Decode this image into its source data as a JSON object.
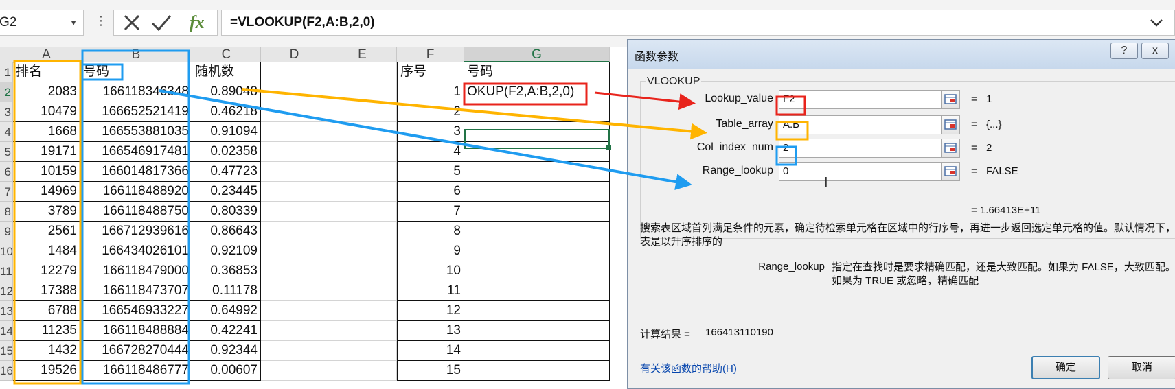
{
  "formula_bar": {
    "name_box": "G2",
    "more": "⋮",
    "cancel_icon": "x-icon",
    "enter_icon": "check-icon",
    "fx": "fx",
    "formula": "=VLOOKUP(F2,A:B,2,0)"
  },
  "columns": [
    "A",
    "B",
    "C",
    "D",
    "E",
    "F",
    "G"
  ],
  "rows": [
    "1",
    "2",
    "3",
    "4",
    "5",
    "6",
    "7",
    "8",
    "9",
    "10",
    "11",
    "12",
    "13",
    "14",
    "15",
    "16"
  ],
  "headers": {
    "A": "排名",
    "B": "号码",
    "C": "随机数",
    "F": "序号",
    "G": "号码"
  },
  "data": [
    {
      "a": "2083",
      "b": "166118346348",
      "c": "0.89048",
      "f": "1",
      "g": "OKUP(F2,A:B,2,0)"
    },
    {
      "a": "10479",
      "b": "166652521419",
      "c": "0.46218",
      "f": "2",
      "g": ""
    },
    {
      "a": "1668",
      "b": "166553881035",
      "c": "0.91094",
      "f": "3",
      "g": ""
    },
    {
      "a": "19171",
      "b": "166546917481",
      "c": "0.02358",
      "f": "4",
      "g": ""
    },
    {
      "a": "10159",
      "b": "166014817366",
      "c": "0.47723",
      "f": "5",
      "g": ""
    },
    {
      "a": "14969",
      "b": "166118488920",
      "c": "0.23445",
      "f": "6",
      "g": ""
    },
    {
      "a": "3789",
      "b": "166118488750",
      "c": "0.80339",
      "f": "7",
      "g": ""
    },
    {
      "a": "2561",
      "b": "166712939616",
      "c": "0.86643",
      "f": "8",
      "g": ""
    },
    {
      "a": "1484",
      "b": "166434026101",
      "c": "0.92109",
      "f": "9",
      "g": ""
    },
    {
      "a": "12279",
      "b": "166118479000",
      "c": "0.36853",
      "f": "10",
      "g": ""
    },
    {
      "a": "17388",
      "b": "166118473707",
      "c": "0.11178",
      "f": "11",
      "g": ""
    },
    {
      "a": "6788",
      "b": "166546933227",
      "c": "0.64992",
      "f": "12",
      "g": ""
    },
    {
      "a": "11235",
      "b": "166118488884",
      "c": "0.42241",
      "f": "13",
      "g": ""
    },
    {
      "a": "1432",
      "b": "166728270444",
      "c": "0.92344",
      "f": "14",
      "g": ""
    },
    {
      "a": "19526",
      "b": "166118486777",
      "c": "0.00607",
      "f": "15",
      "g": ""
    }
  ],
  "dialog": {
    "title": "函数参数",
    "help_btn": "?",
    "close_btn": "x",
    "function_name": "VLOOKUP",
    "args": [
      {
        "label": "Lookup_value",
        "value": "F2",
        "result": "1"
      },
      {
        "label": "Table_array",
        "value": "A:B",
        "result": "{...}"
      },
      {
        "label": "Col_index_num",
        "value": "2",
        "result": "2"
      },
      {
        "label": "Range_lookup",
        "value": "0",
        "result": "FALSE"
      }
    ],
    "eq": "=",
    "formula_result": "=  1.66413E+11",
    "description": "搜索表区域首列满足条件的元素，确定待检索单元格在区域中的行序号，再进一步返回选定单元格的值。默认情况下，表是以升序排序的",
    "arg_name": "Range_lookup",
    "arg_description": "指定在查找时是要求精确匹配，还是大致匹配。如果为 FALSE，大致匹配。如果为 TRUE 或忽略，精确匹配",
    "calc_label": "计算结果 =",
    "calc_value": "166413110190",
    "help_link": "有关该函数的帮助(H)",
    "ok": "确定",
    "cancel": "取消"
  },
  "colors": {
    "red": "#e8241c",
    "orange": "#ffb400",
    "blue": "#1f9cf0",
    "excel_green": "#217346"
  }
}
